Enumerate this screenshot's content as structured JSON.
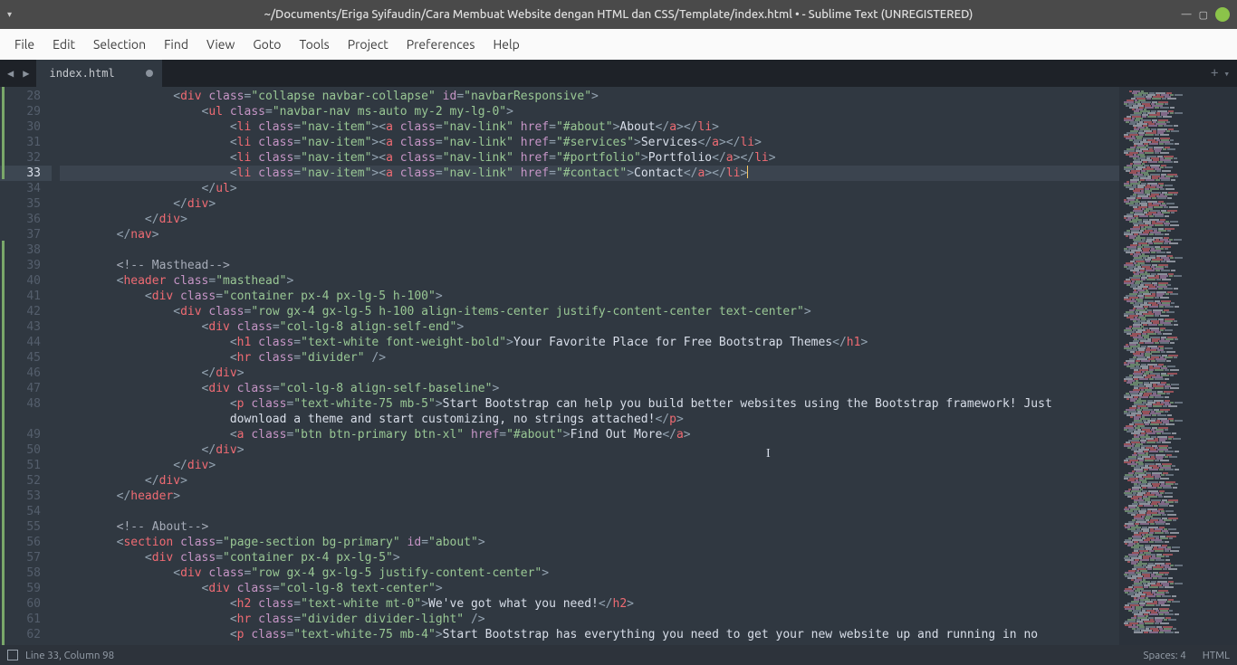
{
  "titlebar": {
    "title": "~/Documents/Eriga Syifaudin/Cara Membuat Website dengan HTML dan CSS/Template/index.html • - Sublime Text (UNREGISTERED)"
  },
  "menubar": [
    "File",
    "Edit",
    "Selection",
    "Find",
    "View",
    "Goto",
    "Tools",
    "Project",
    "Preferences",
    "Help"
  ],
  "tab": {
    "name": "index.html",
    "dirty": "●"
  },
  "status": {
    "pos": "Line 33, Column 98",
    "spaces": "Spaces: 4",
    "lang": "HTML"
  },
  "gutter_start": 28,
  "gutter_end": 62,
  "current_line": 33,
  "code_lines": [
    [
      4,
      "<",
      "div",
      " class",
      "=",
      "\"collapse navbar-collapse\"",
      " id",
      "=",
      "\"navbarResponsive\"",
      ">"
    ],
    [
      5,
      "<",
      "ul",
      " class",
      "=",
      "\"navbar-nav ms-auto my-2 my-lg-0\"",
      ">"
    ],
    [
      6,
      "<",
      "li",
      " class",
      "=",
      "\"nav-item\"",
      "><",
      "a",
      " class",
      "=",
      "\"nav-link\"",
      " href",
      "=",
      "\"#about\"",
      ">",
      "About",
      "</",
      "a",
      "></",
      "li",
      ">"
    ],
    [
      6,
      "<",
      "li",
      " class",
      "=",
      "\"nav-item\"",
      "><",
      "a",
      " class",
      "=",
      "\"nav-link\"",
      " href",
      "=",
      "\"#services\"",
      ">",
      "Services",
      "</",
      "a",
      "></",
      "li",
      ">"
    ],
    [
      6,
      "<",
      "li",
      " class",
      "=",
      "\"nav-item\"",
      "><",
      "a",
      " class",
      "=",
      "\"nav-link\"",
      " href",
      "=",
      "\"#portfolio\"",
      ">",
      "Portfolio",
      "</",
      "a",
      "></",
      "li",
      ">"
    ],
    [
      6,
      "<",
      "li",
      " class",
      "=",
      "\"nav-item\"",
      "><",
      "a",
      " class",
      "=",
      "\"nav-link\"",
      " href",
      "=",
      "\"#contact\"",
      ">",
      "Contact",
      "</",
      "a",
      "></",
      "li",
      ">",
      "CURSOR"
    ],
    [
      5,
      "</",
      "ul",
      ">"
    ],
    [
      4,
      "</",
      "div",
      ">"
    ],
    [
      3,
      "</",
      "div",
      ">"
    ],
    [
      2,
      "</",
      "nav",
      ">"
    ],
    [
      0,
      ""
    ],
    [
      2,
      "<!-- Masthead-->",
      "COMMENT"
    ],
    [
      2,
      "<",
      "header",
      " class",
      "=",
      "\"masthead\"",
      ">"
    ],
    [
      3,
      "<",
      "div",
      " class",
      "=",
      "\"container px-4 px-lg-5 h-100\"",
      ">"
    ],
    [
      4,
      "<",
      "div",
      " class",
      "=",
      "\"row gx-4 gx-lg-5 h-100 align-items-center justify-content-center text-center\"",
      ">"
    ],
    [
      5,
      "<",
      "div",
      " class",
      "=",
      "\"col-lg-8 align-self-end\"",
      ">"
    ],
    [
      6,
      "<",
      "h1",
      " class",
      "=",
      "\"text-white font-weight-bold\"",
      ">",
      "Your Favorite Place for Free Bootstrap Themes",
      "</",
      "h1",
      ">"
    ],
    [
      6,
      "<",
      "hr",
      " class",
      "=",
      "\"divider\"",
      " />"
    ],
    [
      5,
      "</",
      "div",
      ">"
    ],
    [
      5,
      "<",
      "div",
      " class",
      "=",
      "\"col-lg-8 align-self-baseline\"",
      ">"
    ],
    [
      6,
      "<",
      "p",
      " class",
      "=",
      "\"text-white-75 mb-5\"",
      ">",
      "Start Bootstrap can help you build better websites using the Bootstrap framework! Just",
      "WRAP",
      "download a theme and start customizing, no strings attached!",
      "</",
      "p",
      ">"
    ],
    [
      6,
      "<",
      "a",
      " class",
      "=",
      "\"btn btn-primary btn-xl\"",
      " href",
      "=",
      "\"#about\"",
      ">",
      "Find Out More",
      "</",
      "a",
      ">"
    ],
    [
      5,
      "</",
      "div",
      ">"
    ],
    [
      4,
      "</",
      "div",
      ">"
    ],
    [
      3,
      "</",
      "div",
      ">"
    ],
    [
      2,
      "</",
      "header",
      ">"
    ],
    [
      0,
      ""
    ],
    [
      2,
      "<!-- About-->",
      "COMMENT"
    ],
    [
      2,
      "<",
      "section",
      " class",
      "=",
      "\"page-section bg-primary\"",
      " id",
      "=",
      "\"about\"",
      ">"
    ],
    [
      3,
      "<",
      "div",
      " class",
      "=",
      "\"container px-4 px-lg-5\"",
      ">"
    ],
    [
      4,
      "<",
      "div",
      " class",
      "=",
      "\"row gx-4 gx-lg-5 justify-content-center\"",
      ">"
    ],
    [
      5,
      "<",
      "div",
      " class",
      "=",
      "\"col-lg-8 text-center\"",
      ">"
    ],
    [
      6,
      "<",
      "h2",
      " class",
      "=",
      "\"text-white mt-0\"",
      ">",
      "We've got what you need!",
      "</",
      "h2",
      ">"
    ],
    [
      6,
      "<",
      "hr",
      " class",
      "=",
      "\"divider divider-light\"",
      " />"
    ],
    [
      6,
      "<",
      "p",
      " class",
      "=",
      "\"text-white-75 mb-4\"",
      ">",
      "Start Bootstrap has everything you need to get your new website up and running in no"
    ]
  ]
}
